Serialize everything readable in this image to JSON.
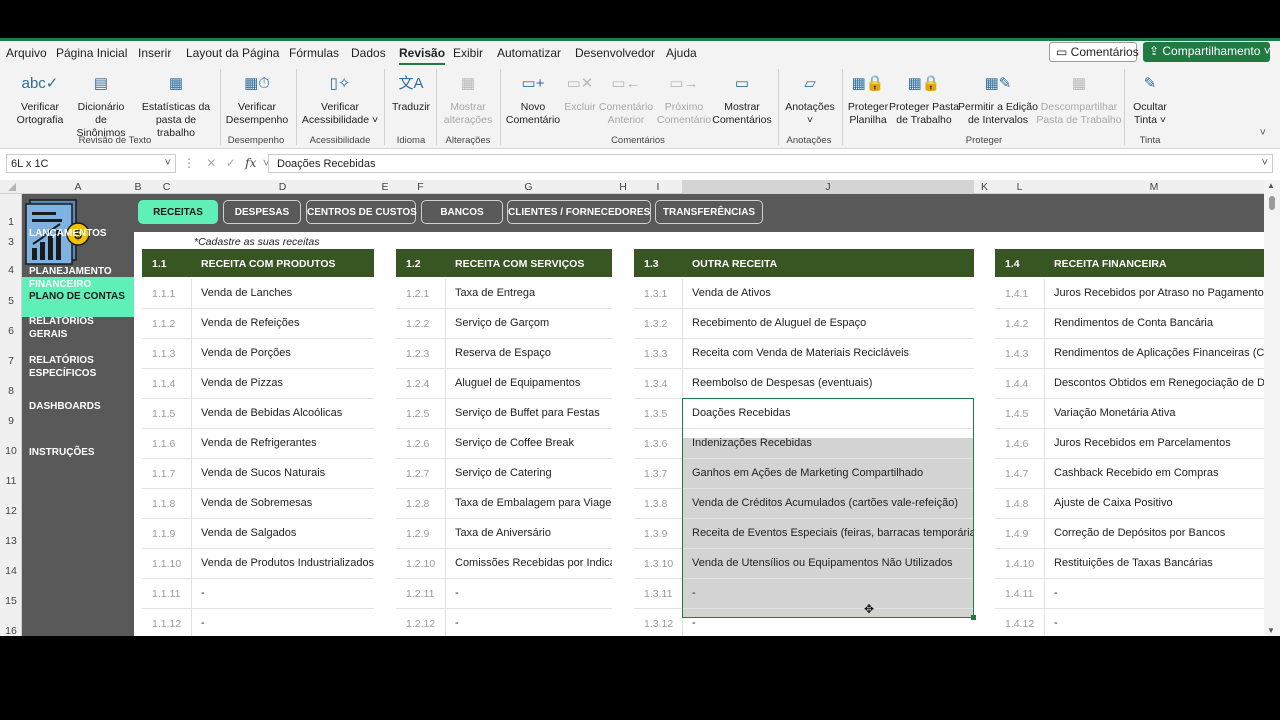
{
  "menu": {
    "items": [
      "Arquivo",
      "Página Inicial",
      "Inserir",
      "Layout da Página",
      "Fórmulas",
      "Dados",
      "Revisão",
      "Exibir",
      "Automatizar",
      "Desenvolvedor",
      "Ajuda"
    ],
    "active": "Revisão",
    "comments_button": "Comentários",
    "share_button": "Compartilhamento"
  },
  "ribbon": {
    "buttons": [
      {
        "label": "Verificar\nOrtografia",
        "icon": "spellcheck-icon",
        "enabled": true
      },
      {
        "label": "Dicionário\nde Sinônimos",
        "icon": "thesaurus-icon",
        "enabled": true
      },
      {
        "label": "Estatísticas da\npasta de trabalho",
        "icon": "workbook-stats-icon",
        "enabled": true
      },
      {
        "label": "Verificar\nDesempenho",
        "icon": "performance-icon",
        "enabled": true
      },
      {
        "label": "Verificar\nAcessibilidade ˅",
        "icon": "accessibility-icon",
        "enabled": true
      },
      {
        "label": "Traduzir",
        "icon": "translate-icon",
        "enabled": true
      },
      {
        "label": "Mostrar\nalterações",
        "icon": "show-changes-icon",
        "enabled": false
      },
      {
        "label": "Novo\nComentário",
        "icon": "new-comment-icon",
        "enabled": true
      },
      {
        "label": "Excluir",
        "icon": "delete-comment-icon",
        "enabled": false
      },
      {
        "label": "Comentário\nAnterior",
        "icon": "previous-comment-icon",
        "enabled": false
      },
      {
        "label": "Próximo\nComentário",
        "icon": "next-comment-icon",
        "enabled": false
      },
      {
        "label": "Mostrar\nComentários",
        "icon": "show-comments-icon",
        "enabled": true
      },
      {
        "label": "Anotações\n˅",
        "icon": "notes-icon",
        "enabled": true
      },
      {
        "label": "Proteger\nPlanilha",
        "icon": "protect-sheet-icon",
        "enabled": true
      },
      {
        "label": "Proteger Pasta\nde Trabalho",
        "icon": "protect-workbook-icon",
        "enabled": true
      },
      {
        "label": "Permitir a Edição\nde Intervalos",
        "icon": "allow-edit-ranges-icon",
        "enabled": true
      },
      {
        "label": "Descompartilhar\nPasta de Trabalho",
        "icon": "unshare-workbook-icon",
        "enabled": false
      },
      {
        "label": "Ocultar\nTinta ˅",
        "icon": "hide-ink-icon",
        "enabled": true
      }
    ],
    "groups": [
      "Revisão de Texto",
      "Desempenho",
      "Acessibilidade",
      "Idioma",
      "Alterações",
      "Comentários",
      "Anotações",
      "Proteger",
      "Tinta"
    ]
  },
  "formula_bar": {
    "name_box": "6L x 1C",
    "fx": "fx",
    "value": "Doações Recebidas"
  },
  "columns": [
    "A",
    "B",
    "C",
    "D",
    "E",
    "F",
    "G",
    "H",
    "I",
    "J",
    "K",
    "L",
    "M"
  ],
  "rows": [
    "1",
    "3",
    "4",
    "5",
    "6",
    "7",
    "8",
    "9",
    "10",
    "11",
    "12",
    "13",
    "14",
    "15",
    "16"
  ],
  "sidebar": {
    "items": [
      "PLANO DE CONTAS",
      "LANÇAMENTOS",
      "PLANEJAMENTO\nFINANCEIRO",
      "RELATÓRIOS GERAIS",
      "RELATÓRIOS\nESPECÍFICOS",
      "DASHBOARDS",
      "INSTRUÇÕES"
    ],
    "active": "PLANO DE CONTAS",
    "logo_symbol": "$"
  },
  "tabs": {
    "items": [
      "RECEITAS",
      "DESPESAS",
      "CENTROS DE CUSTOS",
      "BANCOS",
      "CLIENTES / FORNECEDORES",
      "TRANSFERÊNCIAS"
    ],
    "active": "RECEITAS"
  },
  "note": "*Cadastre as suas receitas",
  "blocks": [
    {
      "code": "1.1",
      "title": "RECEITA COM PRODUTOS",
      "rows": [
        [
          "1.1.1",
          "Venda de Lanches"
        ],
        [
          "1.1.2",
          "Venda de Refeições"
        ],
        [
          "1.1.3",
          "Venda de Porções"
        ],
        [
          "1.1.4",
          "Venda de Pizzas"
        ],
        [
          "1.1.5",
          "Venda de Bebidas Alcoólicas"
        ],
        [
          "1.1.6",
          "Venda de Refrigerantes"
        ],
        [
          "1.1.7",
          "Venda de Sucos Naturais"
        ],
        [
          "1.1.8",
          "Venda de Sobremesas"
        ],
        [
          "1.1.9",
          "Venda de Salgados"
        ],
        [
          "1.1.10",
          "Venda de Produtos Industrializados"
        ],
        [
          "1.1.11",
          "-"
        ],
        [
          "1.1.12",
          "-"
        ]
      ]
    },
    {
      "code": "1.2",
      "title": "RECEITA COM SERVIÇOS",
      "rows": [
        [
          "1.2.1",
          "Taxa de Entrega"
        ],
        [
          "1.2.2",
          "Serviço de Garçom"
        ],
        [
          "1.2.3",
          "Reserva de Espaço"
        ],
        [
          "1.2.4",
          "Aluguel de Equipamentos"
        ],
        [
          "1.2.5",
          "Serviço de Buffet para Festas"
        ],
        [
          "1.2.6",
          "Serviço de Coffee Break"
        ],
        [
          "1.2.7",
          "Serviço de Catering"
        ],
        [
          "1.2.8",
          "Taxa de Embalagem para Viagem"
        ],
        [
          "1.2.9",
          "Taxa de Aniversário"
        ],
        [
          "1.2.10",
          "Comissões Recebidas por Indicação"
        ],
        [
          "1.2.11",
          "-"
        ],
        [
          "1.2.12",
          "-"
        ]
      ]
    },
    {
      "code": "1.3",
      "title": "OUTRA RECEITA",
      "rows": [
        [
          "1.3.1",
          "Venda de Ativos"
        ],
        [
          "1.3.2",
          "Recebimento de Aluguel de Espaço"
        ],
        [
          "1.3.3",
          "Receita com Venda de Materiais Recicláveis"
        ],
        [
          "1.3.4",
          "Reembolso de Despesas (eventuais)"
        ],
        [
          "1.3.5",
          "Doações Recebidas"
        ],
        [
          "1.3.6",
          "Indenizações Recebidas"
        ],
        [
          "1.3.7",
          "Ganhos em Ações de Marketing Compartilhado"
        ],
        [
          "1.3.8",
          "Venda de Créditos Acumulados (cartões vale-refeição)"
        ],
        [
          "1.3.9",
          "Receita de Eventos Especiais (feiras, barracas temporárias)"
        ],
        [
          "1.3.10",
          "Venda de Utensílios ou Equipamentos Não Utilizados"
        ],
        [
          "1.3.11",
          "-"
        ],
        [
          "1.3.12",
          "-"
        ]
      ]
    },
    {
      "code": "1.4",
      "title": "RECEITA FINANCEIRA",
      "rows": [
        [
          "1.4.1",
          "Juros Recebidos por Atraso no Pagamento de"
        ],
        [
          "1.4.2",
          "Rendimentos de Conta Bancária"
        ],
        [
          "1.4.3",
          "Rendimentos de Aplicações Financeiras (CDB,"
        ],
        [
          "1.4.4",
          "Descontos Obtidos em Renegociação de Divid"
        ],
        [
          "1.4.5",
          "Variação Monetária Ativa"
        ],
        [
          "1.4.6",
          "Juros Recebidos em Parcelamentos"
        ],
        [
          "1.4.7",
          "Cashback Recebido em Compras"
        ],
        [
          "1.4.8",
          "Ajuste de Caixa Positivo"
        ],
        [
          "1.4.9",
          "Correção de Depósitos por Bancos"
        ],
        [
          "1.4.10",
          "Restituições de Taxas Bancárias"
        ],
        [
          "1.4.11",
          "-"
        ],
        [
          "1.4.12",
          "-"
        ]
      ]
    }
  ],
  "colors": {
    "accent": "#1f7a43",
    "header_green": "#375623",
    "sidebar_gray": "#595959",
    "active_mint": "#5ff0b8",
    "selection_gray": "#d3d3d3"
  }
}
